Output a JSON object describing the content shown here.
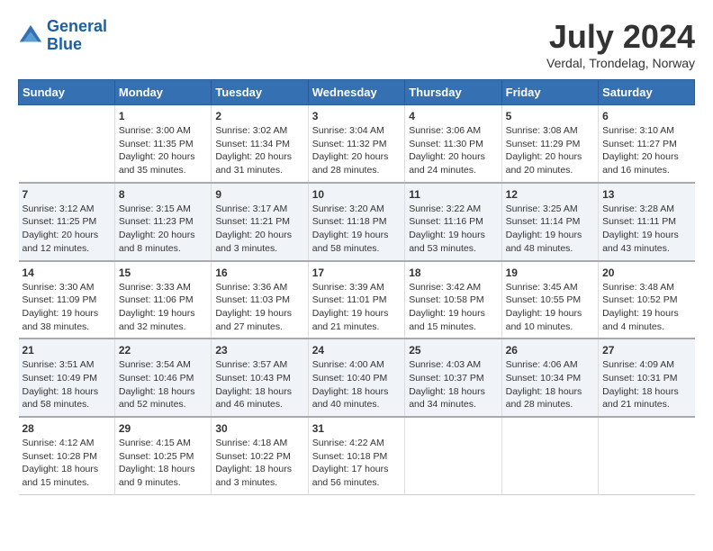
{
  "logo": {
    "line1": "General",
    "line2": "Blue"
  },
  "title": "July 2024",
  "subtitle": "Verdal, Trondelag, Norway",
  "headers": [
    "Sunday",
    "Monday",
    "Tuesday",
    "Wednesday",
    "Thursday",
    "Friday",
    "Saturday"
  ],
  "weeks": [
    [
      {
        "day": "",
        "info": ""
      },
      {
        "day": "1",
        "info": "Sunrise: 3:00 AM\nSunset: 11:35 PM\nDaylight: 20 hours\nand 35 minutes."
      },
      {
        "day": "2",
        "info": "Sunrise: 3:02 AM\nSunset: 11:34 PM\nDaylight: 20 hours\nand 31 minutes."
      },
      {
        "day": "3",
        "info": "Sunrise: 3:04 AM\nSunset: 11:32 PM\nDaylight: 20 hours\nand 28 minutes."
      },
      {
        "day": "4",
        "info": "Sunrise: 3:06 AM\nSunset: 11:30 PM\nDaylight: 20 hours\nand 24 minutes."
      },
      {
        "day": "5",
        "info": "Sunrise: 3:08 AM\nSunset: 11:29 PM\nDaylight: 20 hours\nand 20 minutes."
      },
      {
        "day": "6",
        "info": "Sunrise: 3:10 AM\nSunset: 11:27 PM\nDaylight: 20 hours\nand 16 minutes."
      }
    ],
    [
      {
        "day": "7",
        "info": "Sunrise: 3:12 AM\nSunset: 11:25 PM\nDaylight: 20 hours\nand 12 minutes."
      },
      {
        "day": "8",
        "info": "Sunrise: 3:15 AM\nSunset: 11:23 PM\nDaylight: 20 hours\nand 8 minutes."
      },
      {
        "day": "9",
        "info": "Sunrise: 3:17 AM\nSunset: 11:21 PM\nDaylight: 20 hours\nand 3 minutes."
      },
      {
        "day": "10",
        "info": "Sunrise: 3:20 AM\nSunset: 11:18 PM\nDaylight: 19 hours\nand 58 minutes."
      },
      {
        "day": "11",
        "info": "Sunrise: 3:22 AM\nSunset: 11:16 PM\nDaylight: 19 hours\nand 53 minutes."
      },
      {
        "day": "12",
        "info": "Sunrise: 3:25 AM\nSunset: 11:14 PM\nDaylight: 19 hours\nand 48 minutes."
      },
      {
        "day": "13",
        "info": "Sunrise: 3:28 AM\nSunset: 11:11 PM\nDaylight: 19 hours\nand 43 minutes."
      }
    ],
    [
      {
        "day": "14",
        "info": "Sunrise: 3:30 AM\nSunset: 11:09 PM\nDaylight: 19 hours\nand 38 minutes."
      },
      {
        "day": "15",
        "info": "Sunrise: 3:33 AM\nSunset: 11:06 PM\nDaylight: 19 hours\nand 32 minutes."
      },
      {
        "day": "16",
        "info": "Sunrise: 3:36 AM\nSunset: 11:03 PM\nDaylight: 19 hours\nand 27 minutes."
      },
      {
        "day": "17",
        "info": "Sunrise: 3:39 AM\nSunset: 11:01 PM\nDaylight: 19 hours\nand 21 minutes."
      },
      {
        "day": "18",
        "info": "Sunrise: 3:42 AM\nSunset: 10:58 PM\nDaylight: 19 hours\nand 15 minutes."
      },
      {
        "day": "19",
        "info": "Sunrise: 3:45 AM\nSunset: 10:55 PM\nDaylight: 19 hours\nand 10 minutes."
      },
      {
        "day": "20",
        "info": "Sunrise: 3:48 AM\nSunset: 10:52 PM\nDaylight: 19 hours\nand 4 minutes."
      }
    ],
    [
      {
        "day": "21",
        "info": "Sunrise: 3:51 AM\nSunset: 10:49 PM\nDaylight: 18 hours\nand 58 minutes."
      },
      {
        "day": "22",
        "info": "Sunrise: 3:54 AM\nSunset: 10:46 PM\nDaylight: 18 hours\nand 52 minutes."
      },
      {
        "day": "23",
        "info": "Sunrise: 3:57 AM\nSunset: 10:43 PM\nDaylight: 18 hours\nand 46 minutes."
      },
      {
        "day": "24",
        "info": "Sunrise: 4:00 AM\nSunset: 10:40 PM\nDaylight: 18 hours\nand 40 minutes."
      },
      {
        "day": "25",
        "info": "Sunrise: 4:03 AM\nSunset: 10:37 PM\nDaylight: 18 hours\nand 34 minutes."
      },
      {
        "day": "26",
        "info": "Sunrise: 4:06 AM\nSunset: 10:34 PM\nDaylight: 18 hours\nand 28 minutes."
      },
      {
        "day": "27",
        "info": "Sunrise: 4:09 AM\nSunset: 10:31 PM\nDaylight: 18 hours\nand 21 minutes."
      }
    ],
    [
      {
        "day": "28",
        "info": "Sunrise: 4:12 AM\nSunset: 10:28 PM\nDaylight: 18 hours\nand 15 minutes."
      },
      {
        "day": "29",
        "info": "Sunrise: 4:15 AM\nSunset: 10:25 PM\nDaylight: 18 hours\nand 9 minutes."
      },
      {
        "day": "30",
        "info": "Sunrise: 4:18 AM\nSunset: 10:22 PM\nDaylight: 18 hours\nand 3 minutes."
      },
      {
        "day": "31",
        "info": "Sunrise: 4:22 AM\nSunset: 10:18 PM\nDaylight: 17 hours\nand 56 minutes."
      },
      {
        "day": "",
        "info": ""
      },
      {
        "day": "",
        "info": ""
      },
      {
        "day": "",
        "info": ""
      }
    ]
  ]
}
